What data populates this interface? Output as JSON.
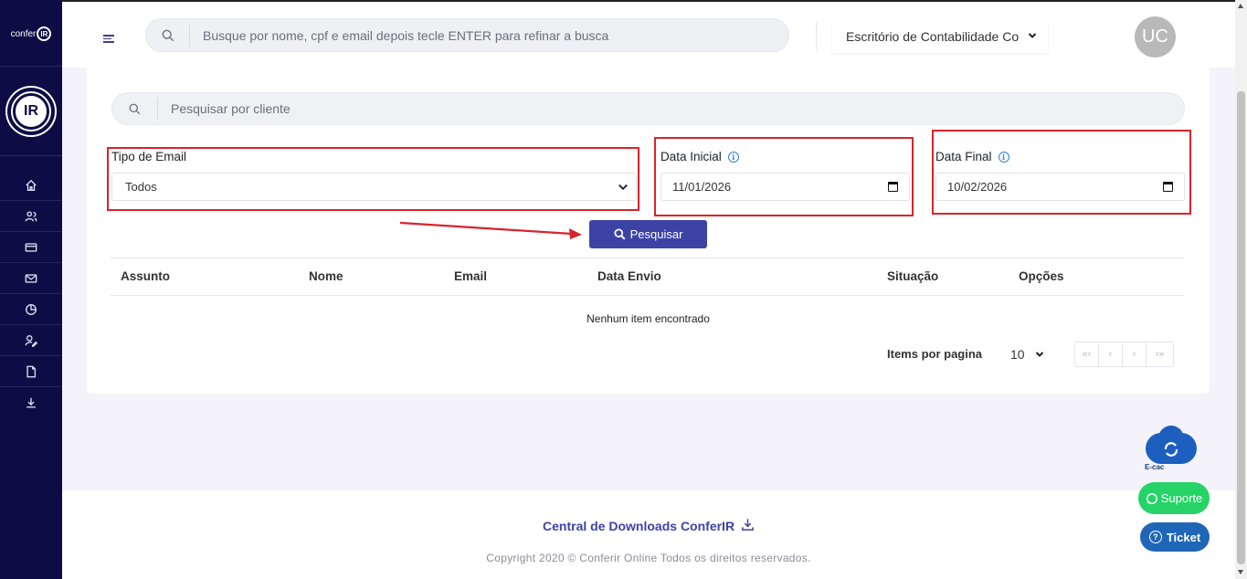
{
  "brand": {
    "small_logo_text": "confer",
    "small_logo_mark": "IR",
    "big_logo_mark": "IR"
  },
  "sidebar": {
    "items": [
      {
        "icon": "home-icon"
      },
      {
        "icon": "users-icon"
      },
      {
        "icon": "card-icon"
      },
      {
        "icon": "mail-icon"
      },
      {
        "icon": "pie-chart-icon"
      },
      {
        "icon": "user-edit-icon"
      },
      {
        "icon": "file-icon"
      },
      {
        "icon": "download-icon"
      }
    ]
  },
  "topbar": {
    "search_placeholder": "Busque por nome, cpf e email depois tecle ENTER para refinar a busca",
    "office": "Escritório de Contabilidade Co",
    "avatar_initials": "UC"
  },
  "filters": {
    "client_search_placeholder": "Pesquisar por cliente",
    "email_type_label": "Tipo de Email",
    "email_type_value": "Todos",
    "start_date_label": "Data Inicial",
    "start_date_value": "11/01/2026",
    "end_date_label": "Data Final",
    "end_date_value": "10/02/2026",
    "search_button": "Pesquisar"
  },
  "table": {
    "columns": [
      "Assunto",
      "Nome",
      "Email",
      "Data Envio",
      "Situação",
      "Opções"
    ],
    "empty_message": "Nenhum item encontrado"
  },
  "pagination": {
    "per_page_label": "Items por pagina",
    "per_page_value": "10",
    "first": "«‹",
    "prev": "‹",
    "next": "›",
    "last": "›»"
  },
  "footer": {
    "downloads_link": "Central de Downloads ConferIR",
    "copyright": "Copyright 2020 © Conferir Online Todos os direitos reservados."
  },
  "floating": {
    "ecac_label": "E-cac",
    "support_label": "Suporte",
    "ticket_label": "Ticket"
  },
  "colors": {
    "sidebar_bg": "#0d0d45",
    "accent": "#3d42a5",
    "highlight_red": "#d9232a",
    "whatsapp": "#25d366",
    "ticket": "#1f67b6"
  }
}
